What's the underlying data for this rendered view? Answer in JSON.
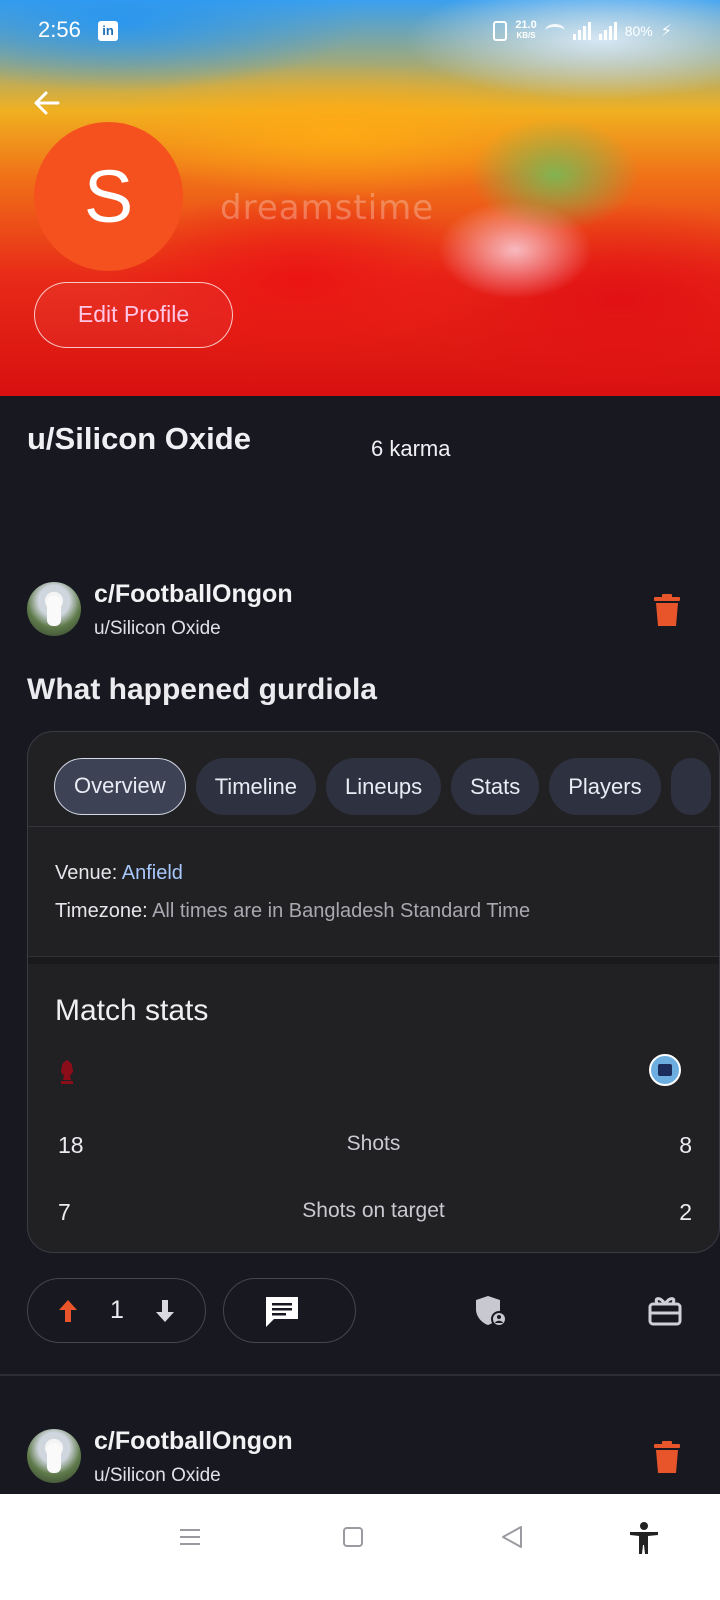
{
  "status_bar": {
    "time": "2:56",
    "net_speed_value": "21.0",
    "net_speed_unit": "KB/S",
    "battery": "80%"
  },
  "banner": {
    "watermark": "dreamstime"
  },
  "profile": {
    "avatar_letter": "S",
    "edit_button": "Edit Profile",
    "username": "u/Silicon Oxide",
    "karma": "6 karma"
  },
  "posts": [
    {
      "community": "c/FootballOngon",
      "author": "u/Silicon Oxide",
      "title": "What happened gurdiola",
      "embed": {
        "tabs": [
          "Overview",
          "Timeline",
          "Lineups",
          "Stats",
          "Players"
        ],
        "active_tab": "Overview",
        "venue_label": "Venue:",
        "venue_value": "Anfield",
        "timezone_label": "Timezone:",
        "timezone_value": "All times are in Bangladesh Standard Time",
        "section_title": "Match stats",
        "stats": [
          {
            "home": "18",
            "label": "Shots",
            "away": "8"
          },
          {
            "home": "7",
            "label": "Shots on target",
            "away": "2"
          }
        ]
      },
      "votes": "1"
    },
    {
      "community": "c/FootballOngon",
      "author": "u/Silicon Oxide"
    }
  ],
  "colors": {
    "background": "#181820",
    "accent_orange": "#f4511e",
    "trash_red": "#e8552a",
    "link_blue": "#a8c7fa"
  }
}
